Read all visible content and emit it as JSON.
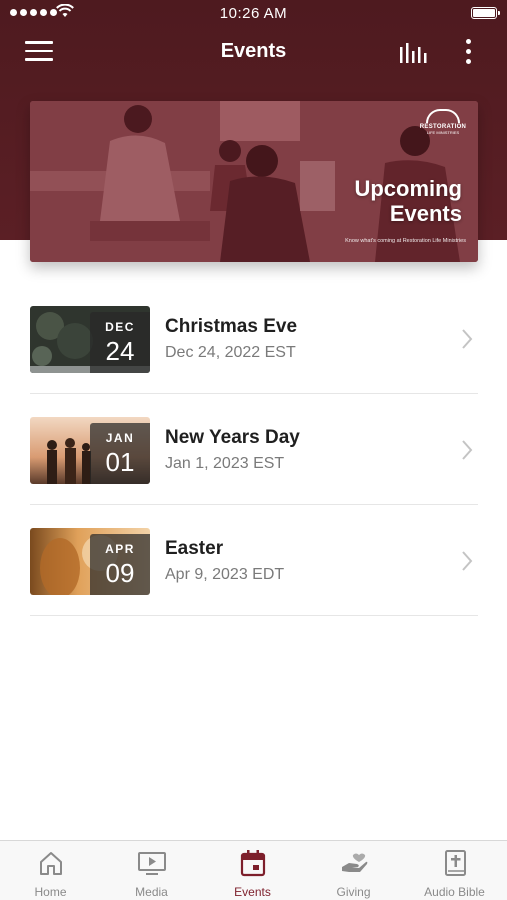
{
  "status_bar": {
    "time": "10:26 AM"
  },
  "nav": {
    "title": "Events"
  },
  "hero": {
    "logo_text": "RESTORATION",
    "logo_subtext": "LIFE MINISTRIES",
    "headline_line1": "Upcoming",
    "headline_line2": "Events",
    "subline": "Know what's coming at Restoration Life Ministries"
  },
  "events": [
    {
      "name": "Christmas Eve",
      "date": "Dec 24, 2022 EST",
      "month": "DEC",
      "day": "24"
    },
    {
      "name": "New Years Day",
      "date": "Jan 1, 2023 EST",
      "month": "JAN",
      "day": "01"
    },
    {
      "name": "Easter",
      "date": "Apr 9, 2023 EDT",
      "month": "APR",
      "day": "09"
    }
  ],
  "tabs": [
    {
      "label": "Home",
      "icon": "home-icon"
    },
    {
      "label": "Media",
      "icon": "media-icon"
    },
    {
      "label": "Events",
      "icon": "calendar-icon",
      "active": true
    },
    {
      "label": "Giving",
      "icon": "giving-hand-icon"
    },
    {
      "label": "Audio Bible",
      "icon": "bible-icon"
    }
  ],
  "colors": {
    "header": "#561d23",
    "accent": "#7d1f2b",
    "tab_inactive": "#8a8a8a"
  }
}
